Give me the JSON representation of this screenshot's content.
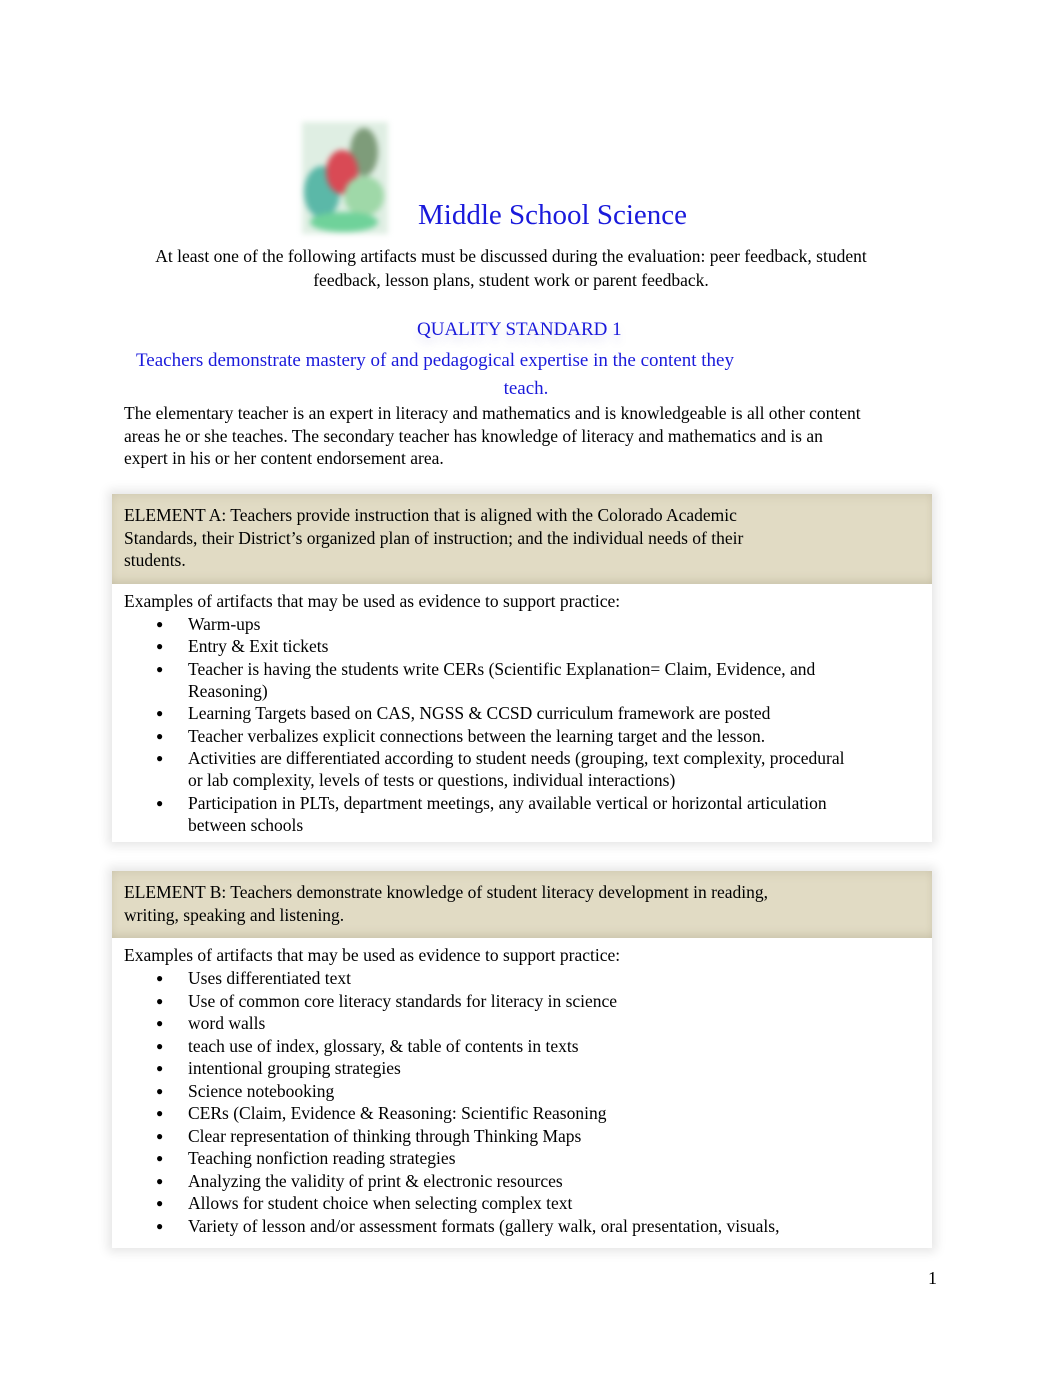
{
  "document": {
    "logo_icon": "science-logo-icon",
    "title": "Middle School Science",
    "intro": "At least one of the following artifacts must be discussed during the evaluation: peer feedback, student feedback, lesson plans, student work or parent feedback.",
    "quality_standard": {
      "label": "QUALITY STANDARD 1",
      "description_line1": "Teachers demonstrate mastery of and pedagogical expertise in the content they",
      "description_line2": "teach.",
      "body": "The elementary teacher is an expert in literacy and mathematics and is knowledgeable is all other content areas he or she teaches. The secondary teacher has knowledge of literacy and mathematics and is an expert in his or her content endorsement area."
    },
    "elements": [
      {
        "header": "ELEMENT A:  Teachers provide instruction that is aligned with the Colorado Academic Standards, their District’s organized plan of instruction; and the individual needs of their students.",
        "examples_intro": "Examples of artifacts that may be used as evidence to support practice:",
        "items": [
          "Warm-ups",
          "Entry & Exit tickets",
          "Teacher is having the students write CERs (Scientific Explanation= Claim, Evidence, and Reasoning)",
          "Learning Targets based on CAS, NGSS & CCSD curriculum framework are posted",
          "Teacher verbalizes explicit connections between the learning target and the lesson.",
          "Activities are differentiated according to student needs (grouping, text complexity, procedural or lab complexity, levels of tests or questions, individual interactions)",
          "Participation in PLTs, department meetings, any available vertical or horizontal articulation between schools"
        ]
      },
      {
        "header": "ELEMENT B:   Teachers demonstrate knowledge of student literacy development in reading, writing, speaking and listening.",
        "examples_intro": "Examples of artifacts that may be used as evidence to support practice:",
        "items": [
          "Uses differentiated text",
          "Use of common core literacy standards for literacy in science",
          "word walls",
          "teach use of index, glossary, & table of contents in texts",
          "intentional grouping strategies",
          "Science notebooking",
          "CERs (Claim, Evidence & Reasoning: Scientific Reasoning",
          "Clear representation of thinking through Thinking Maps",
          "Teaching nonfiction reading strategies",
          "Analyzing the validity of print & electronic resources",
          "Allows for student choice when selecting complex text",
          "Variety of lesson and/or assessment formats (gallery walk, oral presentation, visuals,"
        ]
      }
    ],
    "bullet_glyph": "●",
    "page_number": "1"
  },
  "colors": {
    "title_blue": "#1a1adb",
    "element_header_bg": "#e1dbc4"
  }
}
